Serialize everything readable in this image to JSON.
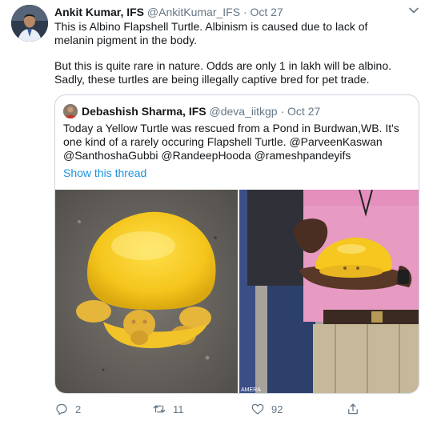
{
  "tweet": {
    "author_name": "Ankit Kumar, IFS",
    "handle": "@AnkitKumar_IFS",
    "separator": "·",
    "date": "Oct 27",
    "paragraph1": "This is Albino Flapshell Turtle. Albinism is caused due to lack of melanin pigment in the body.",
    "paragraph2": "But this is quite rare in nature. Odds are only 1 in lakh will be albino. Sadly, these turtles are being illegally captive bred for pet trade."
  },
  "quoted": {
    "author_name": "Debashish Sharma, IFS",
    "handle": "@deva_iitkgp",
    "separator": "·",
    "date": "Oct 27",
    "text": "Today a Yellow Turtle was rescued from a Pond in Burdwan,WB. It's one kind of a rarely occuring Flapshell Turtle. @ParveenKaswan @SanthoshaGubbi @RandeepHooda @rameshpandeyifs",
    "show_thread": "Show this thread",
    "photo_watermark": "AMERA"
  },
  "actions": {
    "reply_count": "2",
    "retweet_count": "11",
    "like_count": "92"
  },
  "colors": {
    "link": "#1b95e0",
    "muted": "#657786",
    "border": "#ccd6dd",
    "turtle_yellow": "#f4c51c"
  },
  "icons": [
    "chevron-down-icon",
    "reply-icon",
    "retweet-icon",
    "like-icon",
    "share-icon"
  ]
}
